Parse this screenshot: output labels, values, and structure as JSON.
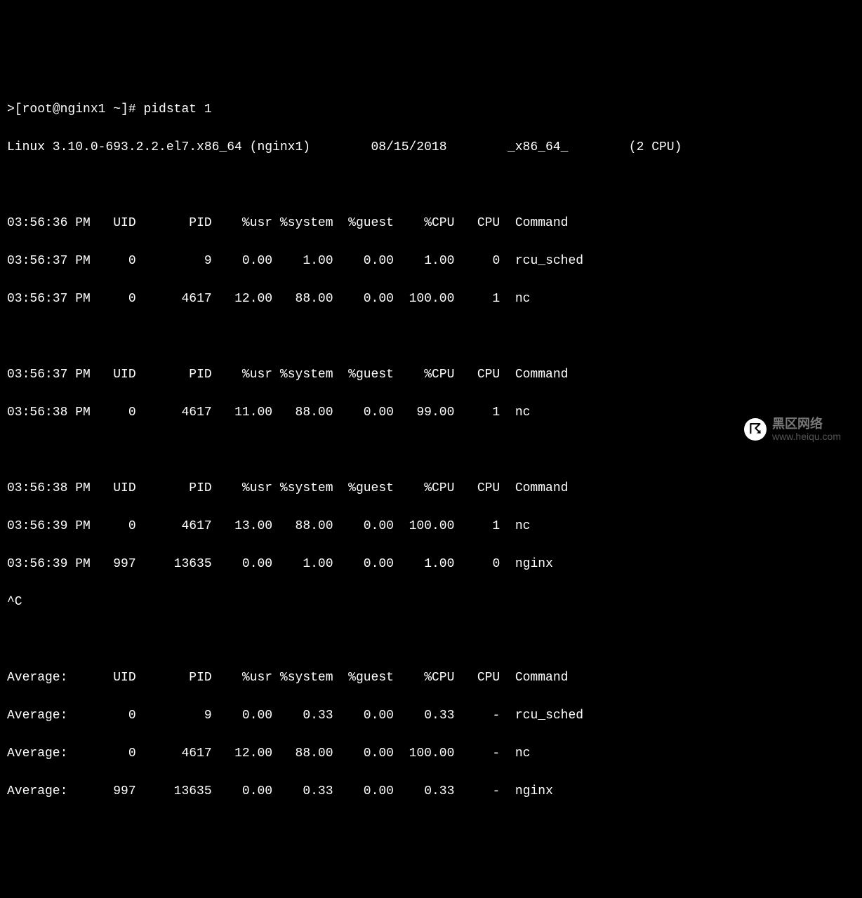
{
  "prompt": {
    "marker": ">",
    "user_host": "[root@nginx1 ~]#",
    "command": "pidstat 1"
  },
  "sysinfo": {
    "kernel": "Linux 3.10.0-693.2.2.el7.x86_64 (nginx1)",
    "date": "08/15/2018",
    "arch": "_x86_64_",
    "cpu_count": "(2 CPU)"
  },
  "headers": {
    "time": "",
    "uid": "UID",
    "pid": "PID",
    "usr": "%usr",
    "system": "%system",
    "guest": "%guest",
    "cpu_pct": "%CPU",
    "cpu": "CPU",
    "command": "Command"
  },
  "block1": {
    "header_time": "03:56:36 PM",
    "rows": [
      {
        "time": "03:56:37 PM",
        "uid": "0",
        "pid": "9",
        "usr": "0.00",
        "system": "1.00",
        "guest": "0.00",
        "cpu_pct": "1.00",
        "cpu": "0",
        "command": "rcu_sched"
      },
      {
        "time": "03:56:37 PM",
        "uid": "0",
        "pid": "4617",
        "usr": "12.00",
        "system": "88.00",
        "guest": "0.00",
        "cpu_pct": "100.00",
        "cpu": "1",
        "command": "nc"
      }
    ]
  },
  "block2": {
    "header_time": "03:56:37 PM",
    "rows": [
      {
        "time": "03:56:38 PM",
        "uid": "0",
        "pid": "4617",
        "usr": "11.00",
        "system": "88.00",
        "guest": "0.00",
        "cpu_pct": "99.00",
        "cpu": "1",
        "command": "nc"
      }
    ]
  },
  "block3": {
    "header_time": "03:56:38 PM",
    "rows": [
      {
        "time": "03:56:39 PM",
        "uid": "0",
        "pid": "4617",
        "usr": "13.00",
        "system": "88.00",
        "guest": "0.00",
        "cpu_pct": "100.00",
        "cpu": "1",
        "command": "nc"
      },
      {
        "time": "03:56:39 PM",
        "uid": "997",
        "pid": "13635",
        "usr": "0.00",
        "system": "1.00",
        "guest": "0.00",
        "cpu_pct": "1.00",
        "cpu": "0",
        "command": "nginx"
      }
    ]
  },
  "interrupt": "^C",
  "average": {
    "label": "Average:",
    "rows": [
      {
        "uid": "0",
        "pid": "9",
        "usr": "0.00",
        "system": "0.33",
        "guest": "0.00",
        "cpu_pct": "0.33",
        "cpu": "-",
        "command": "rcu_sched"
      },
      {
        "uid": "0",
        "pid": "4617",
        "usr": "12.00",
        "system": "88.00",
        "guest": "0.00",
        "cpu_pct": "100.00",
        "cpu": "-",
        "command": "nc"
      },
      {
        "uid": "997",
        "pid": "13635",
        "usr": "0.00",
        "system": "0.33",
        "guest": "0.00",
        "cpu_pct": "0.33",
        "cpu": "-",
        "command": "nginx"
      }
    ]
  },
  "watermark": {
    "glyph": "☈",
    "cn": "黑区网络",
    "url": "www.heiqu.com"
  }
}
